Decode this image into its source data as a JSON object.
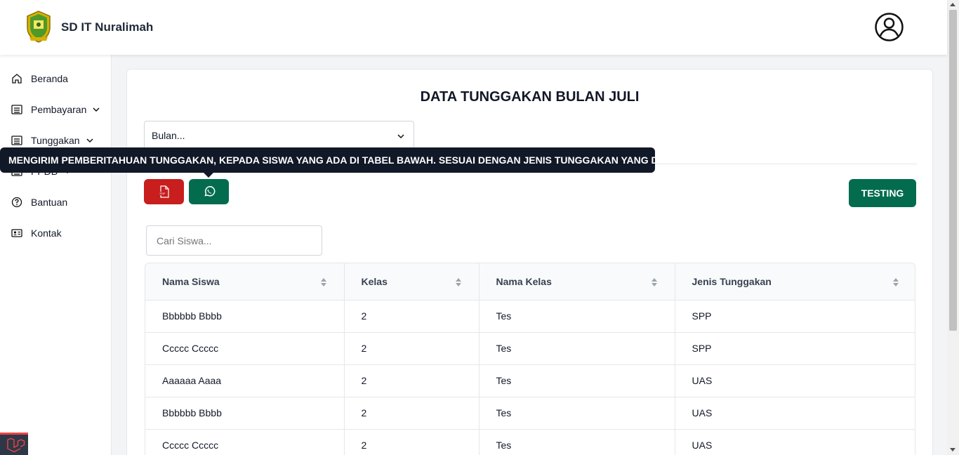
{
  "header": {
    "brand": "SD IT Nuralimah",
    "logo_icon": "school-crest-logo",
    "profile_icon": "user-circle-icon"
  },
  "sidebar": {
    "items": [
      {
        "label": "Beranda",
        "icon": "home-icon",
        "has_dropdown": false
      },
      {
        "label": "Pembayaran",
        "icon": "list-icon",
        "has_dropdown": true
      },
      {
        "label": "Tunggakan",
        "icon": "list-icon",
        "has_dropdown": true
      },
      {
        "label": "PPDB",
        "icon": "list-icon",
        "has_dropdown": true
      },
      {
        "label": "Bantuan",
        "icon": "question-circle-icon",
        "has_dropdown": false
      },
      {
        "label": "Kontak",
        "icon": "contact-card-icon",
        "has_dropdown": false
      }
    ]
  },
  "main": {
    "title": "DATA TUNGGAKAN BULAN JULI",
    "month_select": {
      "value": "Bulan..."
    },
    "tooltip": "MENGIRIM PEMBERITAHUAN TUNGGAKAN, KEPADA SISWA YANG ADA DI TABEL BAWAH. SESUAI DENGAN JENIS TUNGGAKAN YANG DI PILIH",
    "buttons": {
      "pdf_icon": "pdf-file-icon",
      "whatsapp_icon": "whatsapp-icon",
      "testing_label": "TESTING"
    },
    "search": {
      "placeholder": "Cari Siswa..."
    },
    "table": {
      "columns": [
        "Nama Siswa",
        "Kelas",
        "Nama Kelas",
        "Jenis Tunggakan"
      ],
      "rows": [
        [
          "Bbbbbb Bbbb",
          "2",
          "Tes",
          "SPP"
        ],
        [
          "Ccccc Ccccc",
          "2",
          "Tes",
          "SPP"
        ],
        [
          "Aaaaaa Aaaa",
          "2",
          "Tes",
          "UAS"
        ],
        [
          "Bbbbbb Bbbb",
          "2",
          "Tes",
          "UAS"
        ],
        [
          "Ccccc Ccccc",
          "2",
          "Tes",
          "UAS"
        ]
      ]
    }
  },
  "colors": {
    "pdf_button": "#c81e1e",
    "whatsapp_button": "#046c4e",
    "tooltip_bg": "#111827"
  }
}
